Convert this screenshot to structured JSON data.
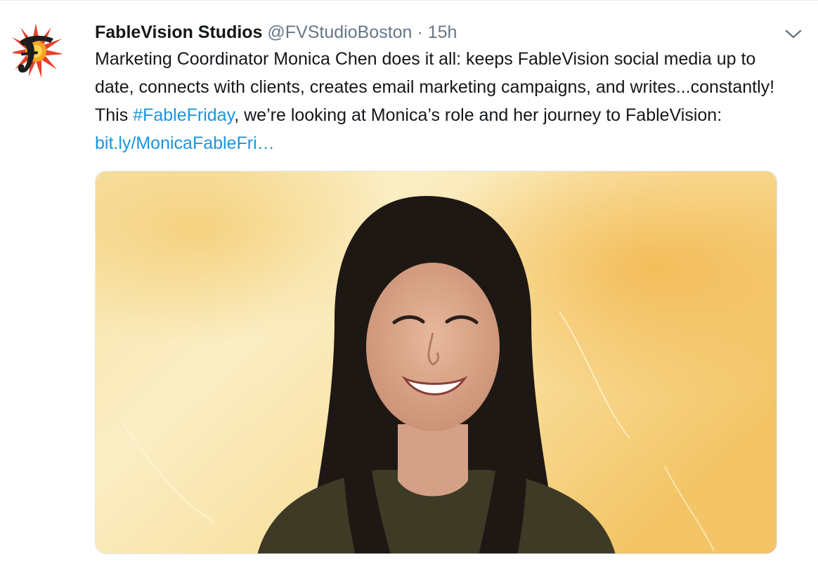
{
  "tweet": {
    "display_name": "FableVision Studios",
    "handle": "@FVStudioBoston",
    "separator": "·",
    "time": "15h",
    "text_part1": "Marketing Coordinator Monica Chen does it all: keeps FableVision social media up to date, connects with clients, creates email marketing campaigns, and writes...constantly! This ",
    "hashtag": "#FableFriday",
    "text_part2": ", we’re looking at Monica’s role and her journey to FableVision: ",
    "link": "bit.ly/MonicaFableFri…"
  },
  "icons": {
    "avatar": "fablevision-logo",
    "menu": "chevron-down-icon"
  },
  "colors": {
    "text": "#14171a",
    "secondary": "#657786",
    "link": "#1b95e0"
  }
}
